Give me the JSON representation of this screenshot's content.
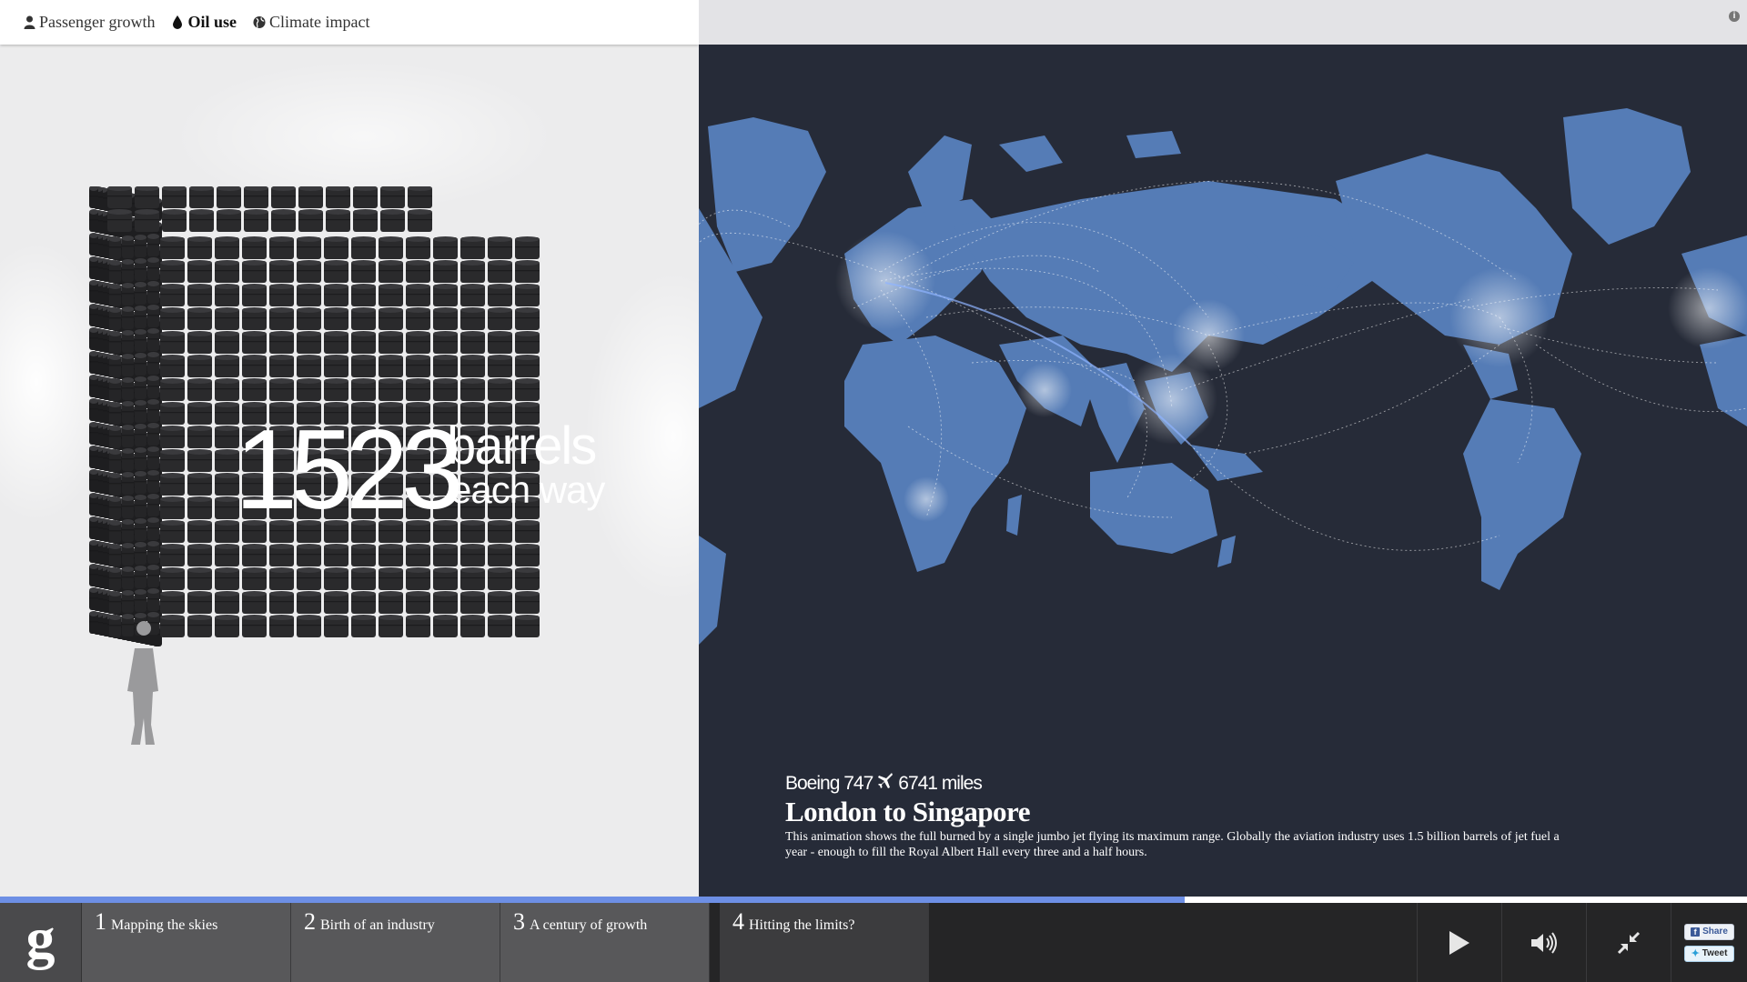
{
  "nav": {
    "tabs": [
      {
        "label": "Passenger growth",
        "icon": "person-icon"
      },
      {
        "label": "Oil use",
        "icon": "drop-icon",
        "active": true
      },
      {
        "label": "Climate impact",
        "icon": "globe-icon"
      }
    ]
  },
  "infographic": {
    "number": "1523",
    "unit": "barrels",
    "qualifier": "each way"
  },
  "route": {
    "aircraft": "Boeing 747",
    "distance": "6741 miles",
    "title": "London to Singapore",
    "description": "This animation shows the full burned by a single jumbo jet flying its maximum range. Globally the aviation industry uses 1.5 billion barrels of jet fuel a year - enough to fill the Royal Albert Hall every three and a half hours."
  },
  "progress": {
    "fraction": 0.678
  },
  "bottom_bar": {
    "logo": "g",
    "chapters": [
      {
        "number": "1",
        "label": "Mapping the skies"
      },
      {
        "number": "2",
        "label": "Birth of an industry"
      },
      {
        "number": "3",
        "label": "A century of growth"
      },
      {
        "number": "4",
        "label": "Hitting the limits?",
        "active": true
      }
    ],
    "controls": [
      "play-icon",
      "volume-icon",
      "collapse-icon"
    ],
    "share": {
      "facebook": "Share",
      "twitter": "Tweet"
    }
  },
  "colors": {
    "map_background": "#262b38",
    "land": "#5b85c4",
    "progress": "#6d8fe5",
    "barrel": "#2a2a2c"
  }
}
